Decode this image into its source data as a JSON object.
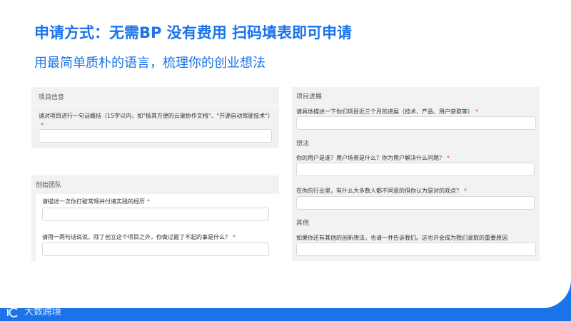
{
  "header": {
    "title": "申请方式：无需BP 没有费用 扫码填表即可申请",
    "subtitle": "用最简单质朴的语言，梳理你的创业想法"
  },
  "required_mark": "*",
  "left": {
    "project_info": {
      "title": "项目信息",
      "question": "请对项目进行一句话概括（15字以内，如\"极其方便的云端协作文档\"、\"开源自动驾驶技术\"）"
    },
    "founding_team": {
      "title": "创始团队",
      "q1": "请描述一次你打破常规并付诸实践的经历",
      "q2": "请用一两句话说说，除了创立这个项目之外，你做过最了不起的事是什么？"
    }
  },
  "right": {
    "progress": {
      "title": "项目进展",
      "question": "请具体描述一下你们项目近三个月的进展（技术、产品、用户获取等）"
    },
    "ideas": {
      "title": "想法",
      "q1": "你的用户是谁？用户场景是什么？你为用户解决什么问题？",
      "q2": "在你的行业里，有什么大多数人都不同意的但你认为是对的观点？"
    },
    "other": {
      "title": "其他",
      "q1": "如果你还有其他的创新想法，也请一并告诉我们。这也许会成为我们录取的重要原因"
    }
  },
  "watermark": "大数跨境",
  "colors": {
    "accent": "#1a73e8",
    "required": "#e53935",
    "card_bg": "#f2f2f2"
  }
}
